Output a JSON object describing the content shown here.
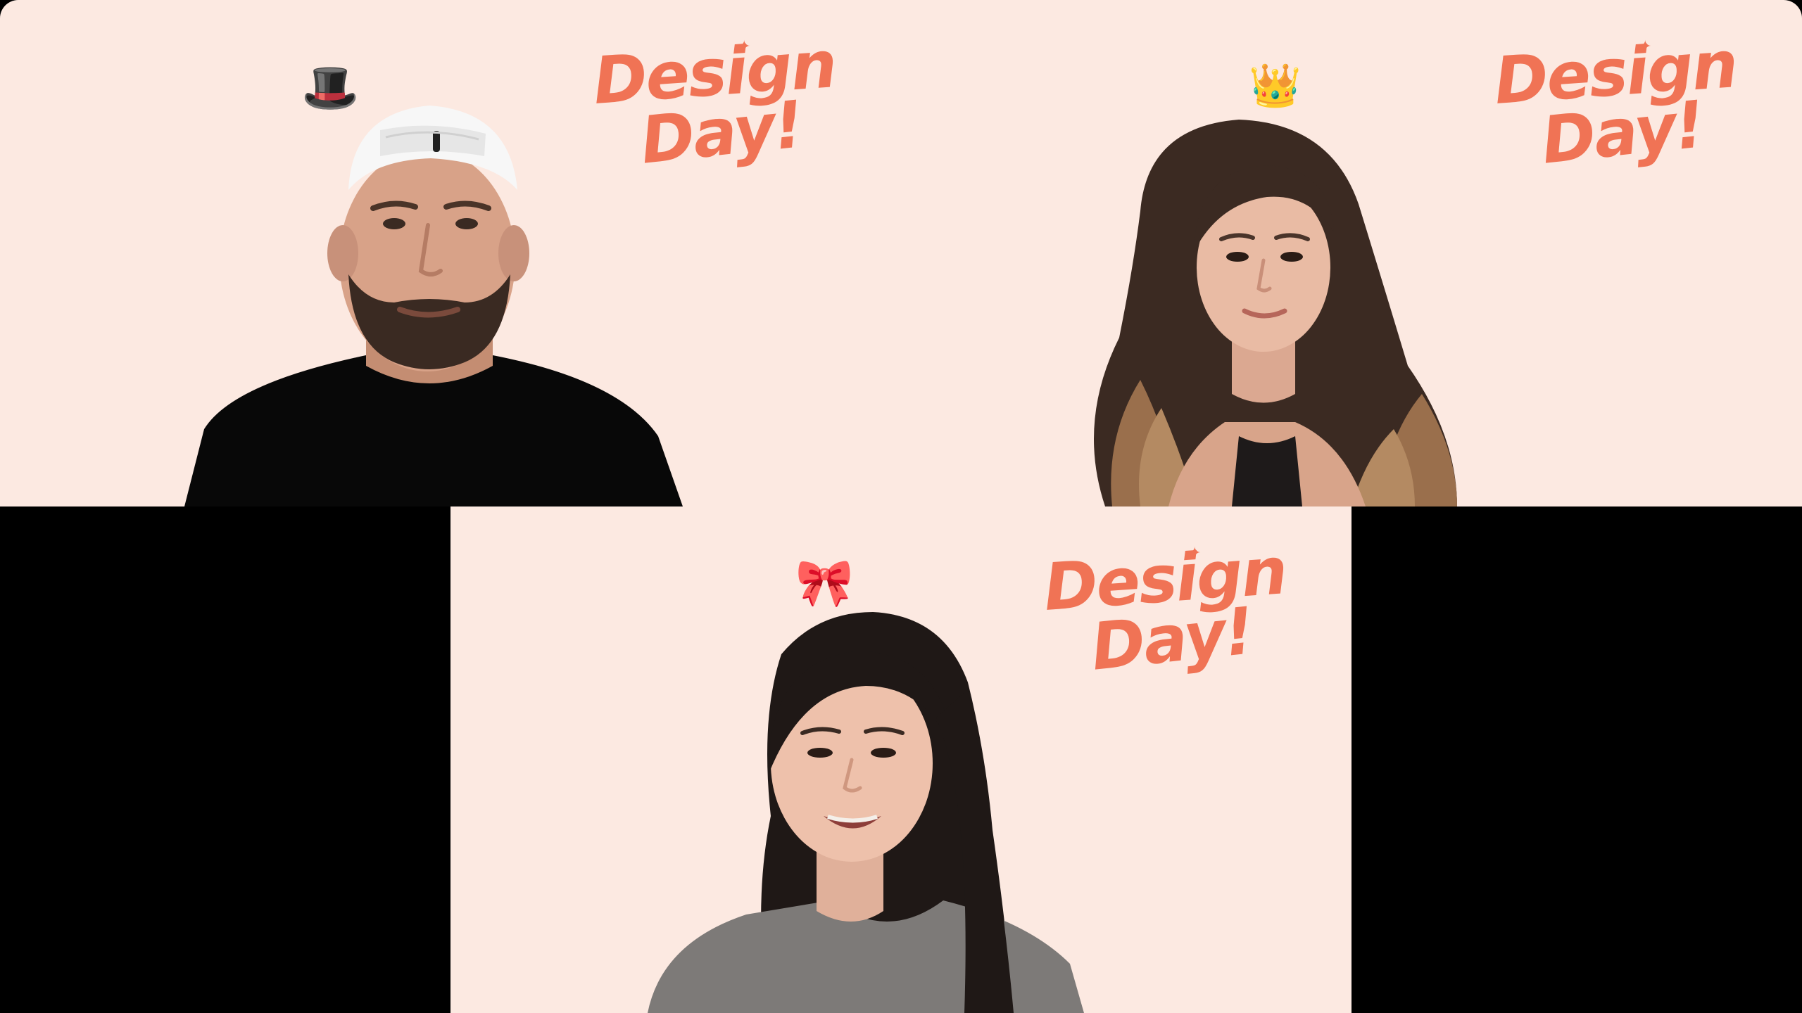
{
  "call": {
    "participants": [
      {
        "id": "top-left",
        "accessory": "top-hat-icon"
      },
      {
        "id": "top-right",
        "accessory": "crown-icon"
      },
      {
        "id": "bottom",
        "accessory": "bow-icon"
      }
    ],
    "background_logo": {
      "line1": "Design",
      "line2": "Day!"
    }
  },
  "colors": {
    "tile_background": "#fce9e1",
    "logo": "#f07355",
    "letterbox": "#000000"
  }
}
